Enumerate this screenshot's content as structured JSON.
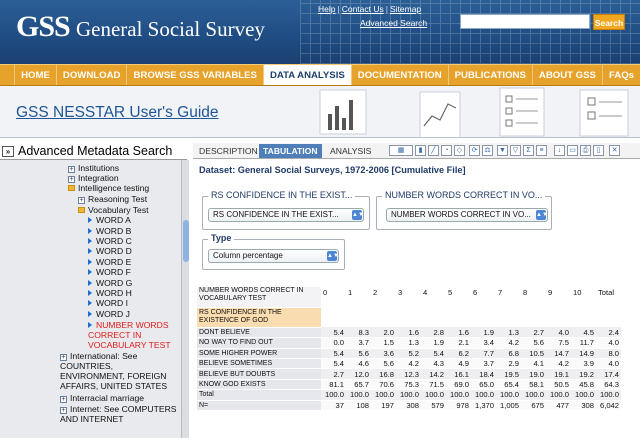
{
  "header": {
    "logo_abbrev": "GSS",
    "logo_full": "General Social Survey",
    "links": [
      "Help",
      "Contact Us",
      "Sitemap"
    ],
    "advanced_search": "Advanced Search",
    "search_button": "Search",
    "search_value": ""
  },
  "nav": [
    "HOME",
    "DOWNLOAD",
    "BROWSE GSS VARIABLES",
    "DATA ANALYSIS",
    "DOCUMENTATION",
    "PUBLICATIONS",
    "ABOUT GSS",
    "FAQs"
  ],
  "banner": {
    "title": "GSS NESSTAR User's Guide"
  },
  "left_panel": {
    "title": "Advanced Metadata Search",
    "tree": [
      {
        "label": "Institutions",
        "kind": "box"
      },
      {
        "label": "Integration",
        "kind": "box"
      },
      {
        "label": "Intelligence testing",
        "kind": "folder"
      },
      {
        "label": "Reasoning Test",
        "kind": "box"
      },
      {
        "label": "Vocabulary Test",
        "kind": "folder"
      },
      {
        "label": "WORD A",
        "kind": "var"
      },
      {
        "label": "WORD B",
        "kind": "var"
      },
      {
        "label": "WORD C",
        "kind": "var"
      },
      {
        "label": "WORD D",
        "kind": "var"
      },
      {
        "label": "WORD E",
        "kind": "var"
      },
      {
        "label": "WORD F",
        "kind": "var"
      },
      {
        "label": "WORD G",
        "kind": "var"
      },
      {
        "label": "WORD H",
        "kind": "var"
      },
      {
        "label": "WORD I",
        "kind": "var"
      },
      {
        "label": "WORD J",
        "kind": "var"
      },
      {
        "label": "NUMBER WORDS CORRECT IN VOCABULARY TEST",
        "kind": "var-selected"
      },
      {
        "label": "International: See COUNTRIES, ENVIRONMENT, FOREIGN AFFAIRS, UNITED STATES",
        "kind": "box"
      },
      {
        "label": "Interracial marriage",
        "kind": "box"
      },
      {
        "label": "Internet: See COMPUTERS AND INTERNET",
        "kind": "box"
      }
    ]
  },
  "tabs": [
    "DESCRIPTION",
    "TABULATION",
    "ANALYSIS"
  ],
  "active_tab": "TABULATION",
  "main": {
    "dataset": "Dataset: General Social Surveys, 1972-2006 [Cumulative File]",
    "row_group": {
      "legend": "RS CONFIDENCE IN THE EXIST...",
      "selected": "RS CONFIDENCE IN THE EXIST..."
    },
    "col_group": {
      "legend": "NUMBER WORDS CORRECT IN VO...",
      "selected": "NUMBER WORDS CORRECT IN VO..."
    },
    "type_group": {
      "legend": "Type",
      "selected": "Column percentage"
    }
  },
  "table": {
    "column_variable": "NUMBER WORDS CORRECT IN VOCABULARY TEST",
    "row_variable": "RS CONFIDENCE IN THE EXISTENCE OF GOD",
    "columns": [
      "0",
      "1",
      "2",
      "3",
      "4",
      "5",
      "6",
      "7",
      "8",
      "9",
      "10",
      "Total"
    ],
    "rows": [
      {
        "label": "DONT BELIEVE",
        "values": [
          "5.4",
          "8.3",
          "2.0",
          "1.6",
          "2.8",
          "1.6",
          "1.9",
          "1.3",
          "2.7",
          "4.0",
          "4.5",
          "2.4"
        ]
      },
      {
        "label": "NO WAY TO FIND OUT",
        "values": [
          "0.0",
          "3.7",
          "1.5",
          "1.3",
          "1.9",
          "2.1",
          "3.4",
          "4.2",
          "5.6",
          "7.5",
          "11.7",
          "4.0"
        ]
      },
      {
        "label": "SOME HIGHER POWER",
        "values": [
          "5.4",
          "5.6",
          "3.6",
          "5.2",
          "5.4",
          "6.2",
          "7.7",
          "6.8",
          "10.5",
          "14.7",
          "14.9",
          "8.0"
        ]
      },
      {
        "label": "BELIEVE SOMETIMES",
        "values": [
          "5.4",
          "4.6",
          "5.6",
          "4.2",
          "4.3",
          "4.9",
          "3.7",
          "2.9",
          "4.1",
          "4.2",
          "3.9",
          "4.0"
        ]
      },
      {
        "label": "BELIEVE BUT DOUBTS",
        "values": [
          "2.7",
          "12.0",
          "16.8",
          "12.3",
          "14.2",
          "16.1",
          "18.4",
          "19.5",
          "19.0",
          "19.1",
          "19.2",
          "17.4"
        ]
      },
      {
        "label": "KNOW GOD EXISTS",
        "values": [
          "81.1",
          "65.7",
          "70.6",
          "75.3",
          "71.5",
          "69.0",
          "65.0",
          "65.4",
          "58.1",
          "50.5",
          "45.8",
          "64.3"
        ]
      },
      {
        "label": "Total",
        "values": [
          "100.0",
          "100.0",
          "100.0",
          "100.0",
          "100.0",
          "100.0",
          "100.0",
          "100.0",
          "100.0",
          "100.0",
          "100.0",
          "100.0"
        ]
      },
      {
        "label": "N=",
        "values": [
          "37",
          "108",
          "197",
          "308",
          "579",
          "978",
          "1,370",
          "1,005",
          "675",
          "477",
          "308",
          "6,042"
        ]
      }
    ]
  }
}
